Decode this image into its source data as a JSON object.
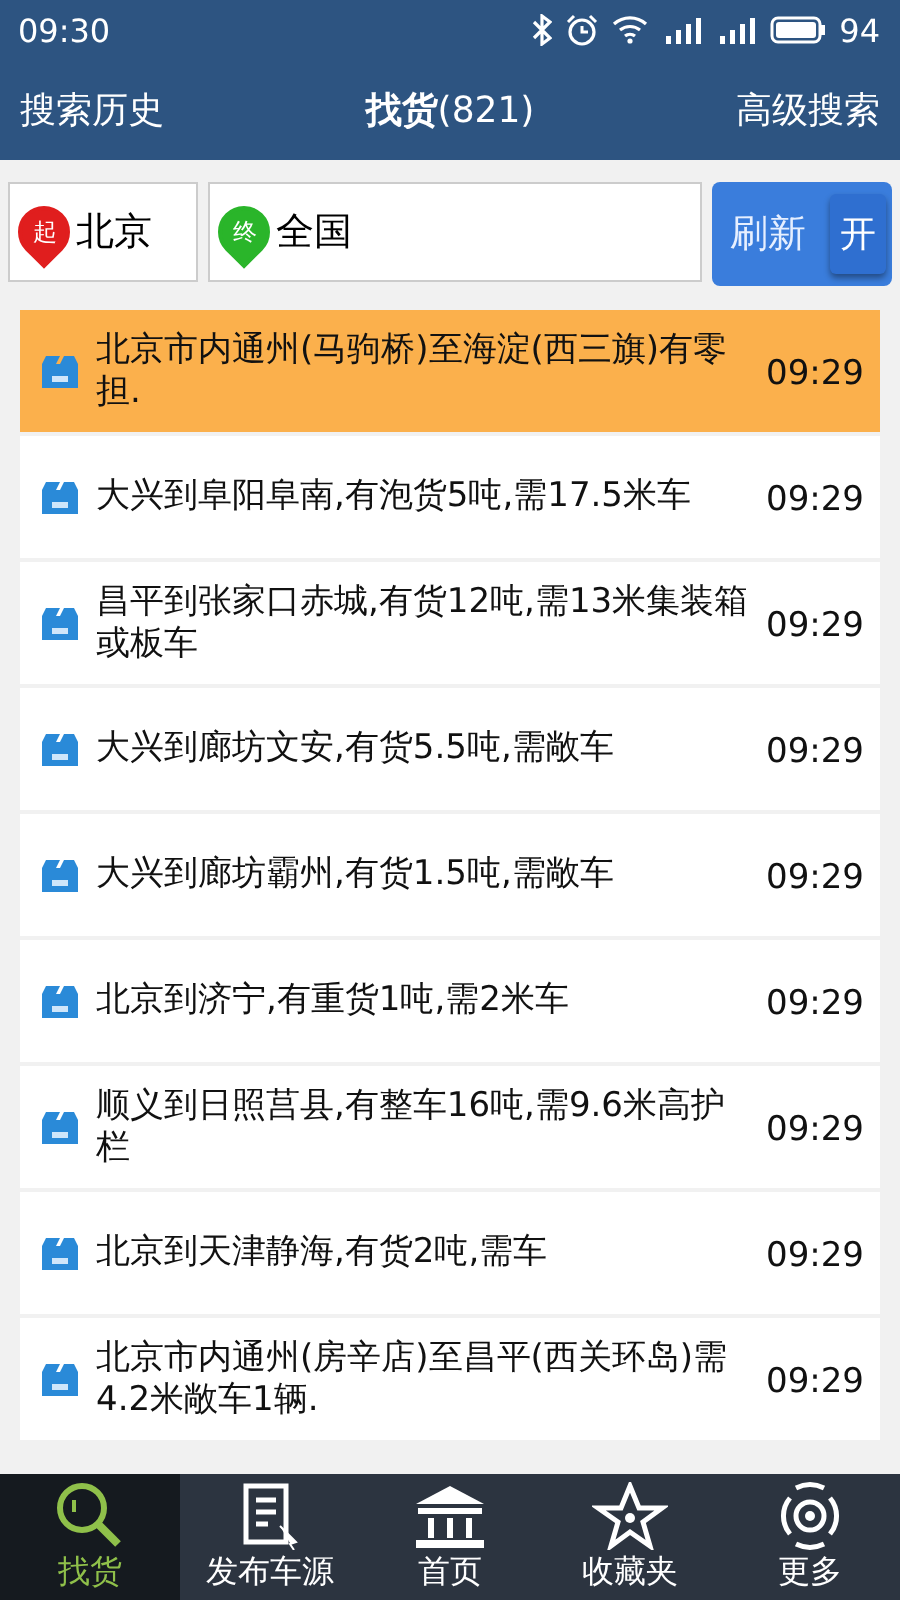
{
  "status_bar": {
    "time": "09:30",
    "battery": "94"
  },
  "header": {
    "left": "搜索历史",
    "title": "**找货**(821)",
    "right": "高级搜索"
  },
  "search": {
    "from_badge": "起",
    "from": "北京",
    "to_badge": "终",
    "to": "全国",
    "refresh": "刷新",
    "toggle": "开",
    "toggle_on": true
  },
  "rows": [
    {
      "text": "北京市内通州(马驹桥)至海淀(西三旗)有零担.",
      "time": "09:29",
      "selected": true
    },
    {
      "text": "大兴到阜阳阜南,有泡货5吨,需17.5米车",
      "time": "09:29",
      "selected": false
    },
    {
      "text": "昌平到张家口赤城,有货12吨,需13米集装箱或板车",
      "time": "09:29",
      "selected": false
    },
    {
      "text": "大兴到廊坊文安,有货5.5吨,需敞车",
      "time": "09:29",
      "selected": false
    },
    {
      "text": "大兴到廊坊霸州,有货1.5吨,需敞车",
      "time": "09:29",
      "selected": false
    },
    {
      "text": "北京到济宁,有重货1吨,需2米车",
      "time": "09:29",
      "selected": false
    },
    {
      "text": "顺义到日照莒县,有整车16吨,需9.6米高护栏",
      "time": "09:29",
      "selected": false
    },
    {
      "text": "北京到天津静海,有货2吨,需车",
      "time": "09:29",
      "selected": false
    },
    {
      "text": "北京市内通州(房辛店)至昌平(西关环岛)需4.2米敞车1辆.",
      "time": "09:29",
      "selected": false
    }
  ],
  "nav": [
    {
      "kind": "search",
      "label": "找货",
      "selected": true
    },
    {
      "kind": "publish",
      "label": "发布车源",
      "selected": false
    },
    {
      "kind": "home",
      "label": "首页",
      "selected": false
    },
    {
      "kind": "favorite",
      "label": "收藏夹",
      "selected": false
    },
    {
      "kind": "more",
      "label": "更多",
      "selected": false
    }
  ]
}
